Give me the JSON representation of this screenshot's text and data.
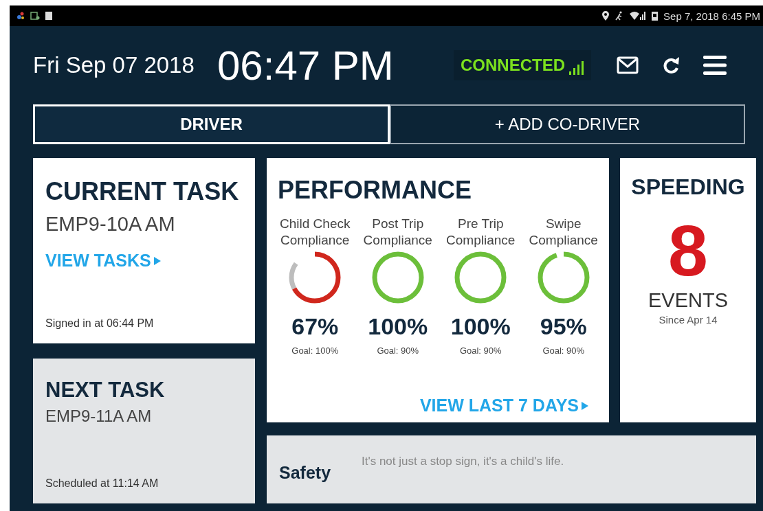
{
  "status_bar": {
    "time": "Sep 7, 2018 6:45 PM"
  },
  "header": {
    "date": "Fri Sep 07 2018",
    "clock": "06:47 PM",
    "connection": "CONNECTED"
  },
  "tabs": [
    {
      "label": "DRIVER",
      "selected": true
    },
    {
      "label": "+ ADD CO-DRIVER",
      "selected": false
    }
  ],
  "current_task": {
    "title": "CURRENT TASK",
    "task": "EMP9-10A AM",
    "link": "VIEW TASKS",
    "note": "Signed in at 06:44 PM"
  },
  "next_task": {
    "title": "NEXT TASK",
    "task": "EMP9-11A AM",
    "note": "Scheduled at 11:14 AM"
  },
  "performance": {
    "title": "PERFORMANCE",
    "metrics": [
      {
        "label": "Child Check Compliance",
        "level": 0.67,
        "color": "#d0271d",
        "value": "67%",
        "goal": "Goal: 100%"
      },
      {
        "label": "Post Trip Compliance",
        "level": 1,
        "color": "#6cbf3a",
        "value": "100%",
        "goal": "Goal: 90%"
      },
      {
        "label": "Pre Trip Compliance",
        "level": 1,
        "color": "#6cbf3a",
        "value": "100%",
        "goal": "Goal: 90%"
      },
      {
        "label": "Swipe Compliance",
        "level": 0.95,
        "color": "#6cbf3a",
        "value": "95%",
        "goal": "Goal: 90%"
      }
    ],
    "link": "VIEW LAST 7 DAYS"
  },
  "speeding": {
    "title": "SPEEDING",
    "count": "8",
    "unit": "EVENTS",
    "since": "Since Apr 14"
  },
  "safety": {
    "title": "Safety",
    "message": "It's not just a stop sign, it's a child's life."
  }
}
